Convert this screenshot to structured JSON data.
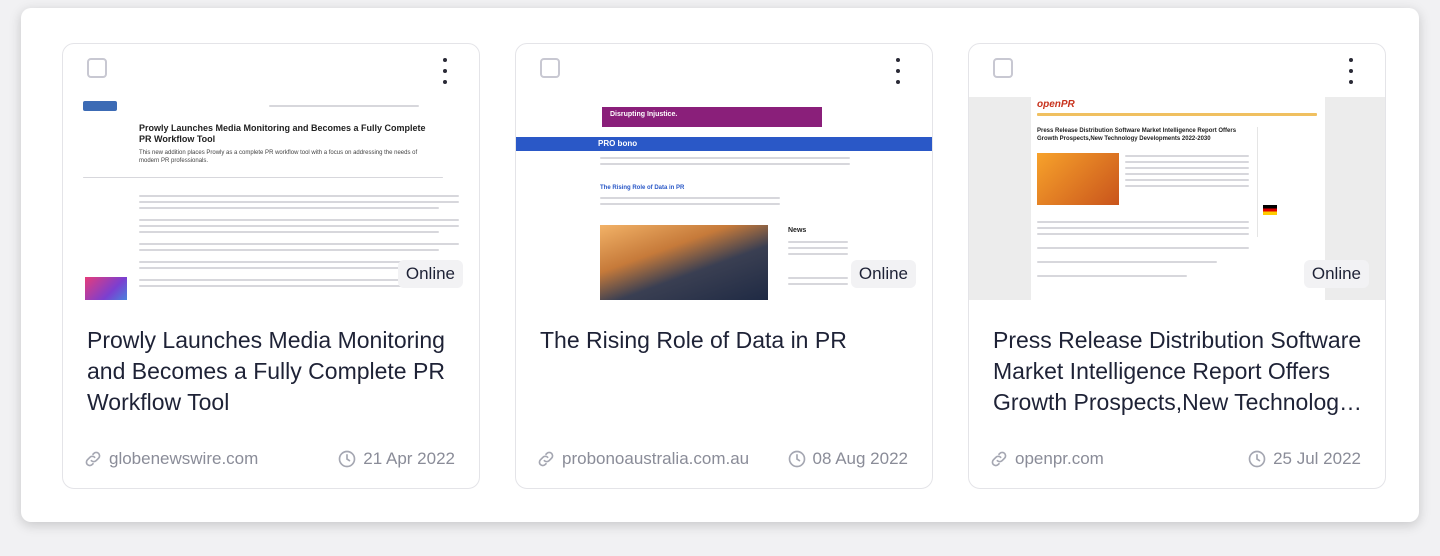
{
  "cards": [
    {
      "title": "Prowly Launches Media Monitoring and Becomes a Fully Complete PR Workflow Tool",
      "status": "Online",
      "domain": "globenewswire.com",
      "date": "21 Apr 2022",
      "thumb": {
        "headline": "Prowly Launches Media Monitoring and Becomes a Fully Complete PR Workflow Tool",
        "subhead": "This new addition places Prowly as a complete PR workflow tool with a focus on addressing the needs of modern PR professionals."
      }
    },
    {
      "title": "The Rising Role of Data in PR",
      "status": "Online",
      "domain": "probonoaustralia.com.au",
      "date": "08 Aug 2022",
      "thumb": {
        "banner": "Disrupting Injustice.",
        "site": "PRO bono",
        "headline": "The Rising Role of Data in PR",
        "sidebar": "News"
      }
    },
    {
      "title": "Press Release Distribution Software Market Intelligence Report Offers Growth Prospects,New Technology Developments 2022-2030",
      "status": "Online",
      "domain": "openpr.com",
      "date": "25 Jul 2022",
      "thumb": {
        "logo": "openPR",
        "headline": "Press Release Distribution Software Market Intelligence Report Offers Growth Prospects,New Technology Developments 2022-2030"
      }
    }
  ],
  "colors": {
    "text": "#1e2236",
    "muted": "#8a8c98",
    "accent": "#2f58c9"
  }
}
